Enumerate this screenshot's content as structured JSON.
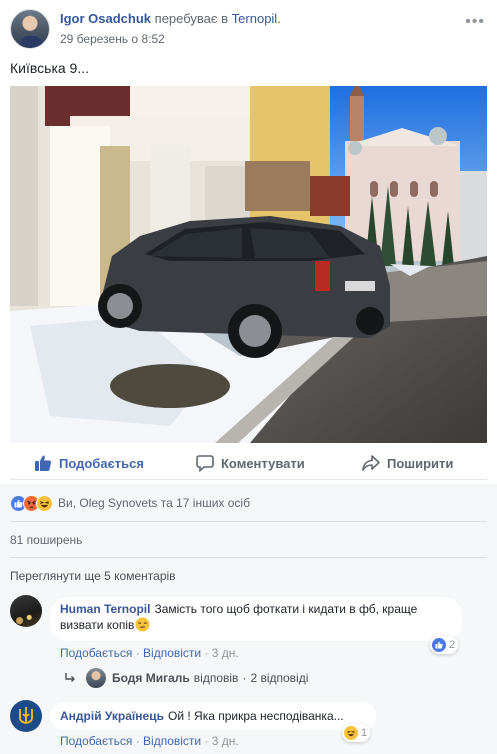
{
  "post": {
    "author": "Igor Osadchuk",
    "action_text": "перебуває в",
    "place": "Ternopil.",
    "timestamp": "29 березень о 8:52",
    "text": "Київська 9...",
    "more_icon": "ellipsis-icon",
    "photo_description_icon": "photo-parked-suv-on-sidewalk"
  },
  "actions": {
    "like": "Подобається",
    "comment": "Коментувати",
    "share": "Поширити"
  },
  "reactions": {
    "icons": [
      "like-icon",
      "angry-icon",
      "haha-icon"
    ],
    "summary": "Ви, Oleg Synovets та 17 інших осіб"
  },
  "shares": "81 поширень",
  "view_more": "Переглянути ще 5 коментарів",
  "comments": [
    {
      "author": "Human Ternopil",
      "text": "Замість того щоб фоткати і кидати в фб, краще визвати копів",
      "emoji_icon": "unamused-face-icon",
      "like_label": "Подобається",
      "reply_label": "Відповісти",
      "age": "3 дн.",
      "reaction_icon": "like-icon",
      "reaction_count": "2",
      "reply_summary": {
        "author": "Бодя Мигаль",
        "verb": "відповів",
        "count_text": "2 відповіді"
      }
    },
    {
      "author": "Андрій Українець",
      "text": "Ой ! Яка прикра несподіванка...",
      "like_label": "Подобається",
      "reply_label": "Відповісти",
      "age": "3 дн.",
      "reaction_icon": "haha-icon",
      "reaction_count": "1"
    }
  ],
  "colors": {
    "link_blue": "#365899",
    "like_blue": "#4267b2",
    "meta_gray": "#90949c",
    "summary_bg": "#f6f7f9"
  }
}
